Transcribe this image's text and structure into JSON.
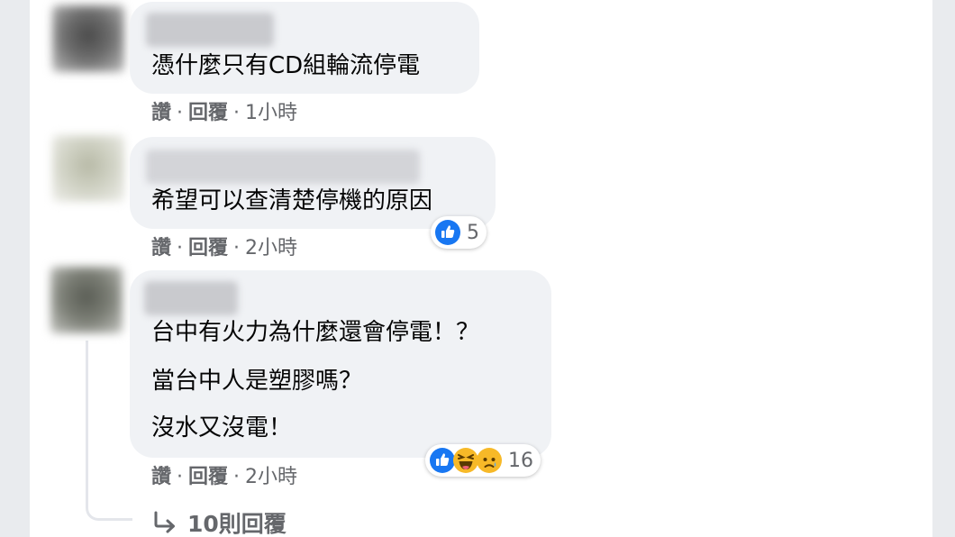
{
  "colors": {
    "page_bg": "#e9ebee",
    "panel_bg": "#ffffff",
    "bubble_bg": "#f0f2f5",
    "meta_text": "#65676b",
    "like_blue": "#1877f2"
  },
  "comments": [
    {
      "text_lines": [
        "憑什麼只有CD組輪流停電"
      ],
      "actions": {
        "like": "讚",
        "reply": "回覆",
        "time": "1小時"
      },
      "reactions": null
    },
    {
      "text_lines": [
        "希望可以查清楚停機的原因"
      ],
      "actions": {
        "like": "讚",
        "reply": "回覆",
        "time": "2小時"
      },
      "reactions": {
        "icons": [
          "like-icon"
        ],
        "count": "5"
      }
    },
    {
      "text_lines": [
        "台中有火力為什麼還會停電！？",
        "當台中人是塑膠嗎？",
        "沒水又沒電！"
      ],
      "actions": {
        "like": "讚",
        "reply": "回覆",
        "time": "2小時"
      },
      "reactions": {
        "icons": [
          "like-icon",
          "haha-icon",
          "sad-icon"
        ],
        "count": "16"
      }
    }
  ],
  "separator": "·",
  "view_replies": {
    "icon": "reply-arrow-icon",
    "label": "10則回覆"
  }
}
